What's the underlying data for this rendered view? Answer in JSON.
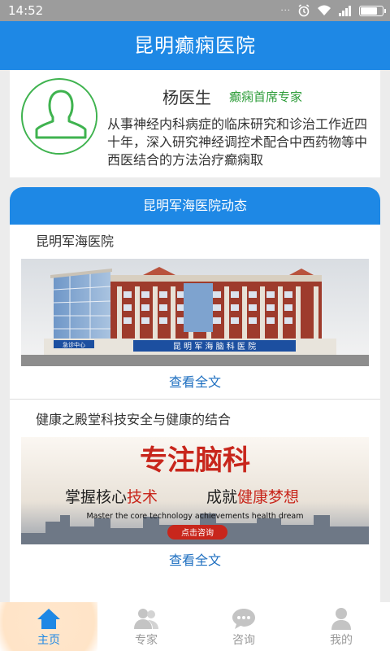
{
  "status_bar": {
    "time": "14:52",
    "dots": "···"
  },
  "header": {
    "title": "昆明癫痫医院"
  },
  "doctor": {
    "name": "杨医生",
    "title": "癫痫首席专家",
    "description": "从事神经内科病症的临床研究和诊治工作近四十年，深入研究神经调控术配合中西药物等中西医结合的方法治疗癫痫取"
  },
  "news": {
    "section_title": "昆明军海医院动态",
    "items": [
      {
        "title": "昆明军海医院",
        "read_more": "查看全文"
      },
      {
        "title": "健康之殿堂科技安全与健康的结合",
        "banner": {
          "headline": "专注脑科",
          "slogan_a": "掌握核心",
          "slogan_a_hl": "技术",
          "slogan_b": "成就",
          "slogan_b_hl": "健康梦想",
          "english": "Master the core technology achievements health dream",
          "button": "点击咨询"
        },
        "read_more": "查看全文"
      }
    ],
    "building_sign": "昆 明 军 海 脑 科 医 院",
    "building_sign_en": "KUNMING JUNHAI NAO KE HOSPITAL",
    "building_small": "急诊中心"
  },
  "tabbar": {
    "tabs": [
      {
        "label": "主页",
        "icon": "home-icon"
      },
      {
        "label": "专家",
        "icon": "experts-icon"
      },
      {
        "label": "咨询",
        "icon": "chat-icon"
      },
      {
        "label": "我的",
        "icon": "profile-icon"
      }
    ]
  },
  "colors": {
    "primary": "#1e88e5",
    "accent_green": "#2e9d3a",
    "banner_red": "#c8261c"
  }
}
